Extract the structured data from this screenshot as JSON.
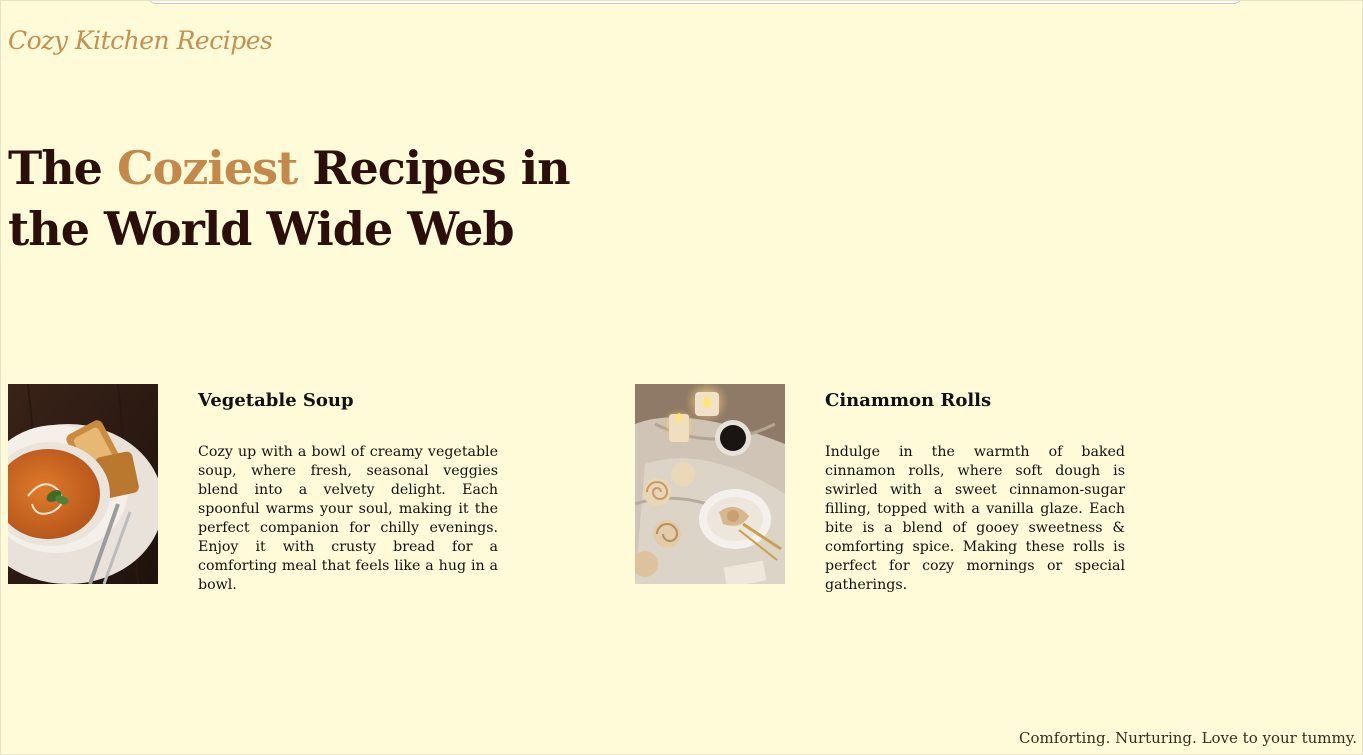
{
  "site": {
    "logo": "Cozy Kitchen Recipes"
  },
  "hero": {
    "line1_pre": "The ",
    "accent": "Coziest",
    "line1_post": " Recipes in",
    "line2": "the World Wide Web"
  },
  "recipes": [
    {
      "title": "Vegetable Soup",
      "description": "Cozy up with a bowl of creamy vegetable soup, where fresh, seasonal veggies blend into a velvety delight. Each spoonful warms your soul, making it the perfect companion for chilly evenings. Enjoy it with crusty bread for a comforting meal that feels like a hug in a bowl.",
      "image": "tomato-soup-bowl-photo"
    },
    {
      "title": "Cinammon Rolls",
      "description": "Indulge in the warmth of baked cinnamon rolls, where soft dough is swirled with a sweet cinnamon-sugar filling, topped with a vanilla glaze. Each bite is a blend of gooey sweetness & comforting spice. Making these rolls is perfect for cozy mornings or special gatherings.",
      "image": "cinnamon-rolls-candles-photo"
    }
  ],
  "footer": {
    "tagline": "Comforting. Nurturing. Love to your tummy."
  },
  "colors": {
    "background": "#fffad8",
    "heading": "#2a0f0a",
    "accent": "#c4884a",
    "logo": "#c49052"
  }
}
